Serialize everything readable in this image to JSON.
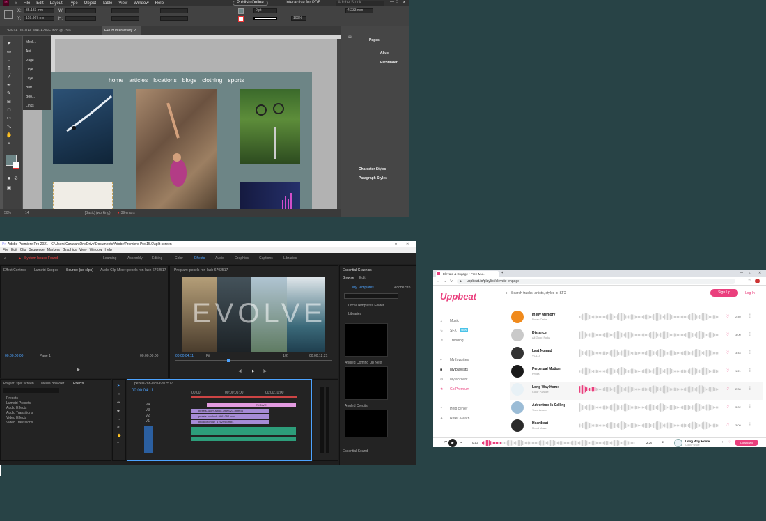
{
  "indesign": {
    "menus": [
      "File",
      "Edit",
      "Layout",
      "Type",
      "Object",
      "Table",
      "View",
      "Window",
      "Help"
    ],
    "publish_label": "Publish Online",
    "interactive_preset": "Interactive for PDF",
    "search_placeholder": "Adobe Stock",
    "x_value": "35.133 mm",
    "y_value": "159.967 mm",
    "stroke_value": "0 pt",
    "stroke_width": "4.233 mm",
    "zoom_pct": "100%",
    "doc_tabs": [
      "*EMLA DIGITAL MAGAZINE.indd @ 75%",
      "EPUB Interactivity P..."
    ],
    "flyout_items": [
      "Med...",
      "Ani...",
      "Page...",
      "Obje...",
      "Laye...",
      "Butt...",
      "Boo...",
      "Links"
    ],
    "nav_links": [
      "home",
      "articles",
      "locations",
      "blogs",
      "clothing",
      "sports"
    ],
    "status": {
      "zoom": "50%",
      "page": "14",
      "style": "[Basic] (working)",
      "errors": "39 errors"
    },
    "panels": [
      "Pages",
      "Align",
      "Pathfinder",
      "Character Styles",
      "Paragraph Styles"
    ]
  },
  "premiere": {
    "title": "Adobe Premiere Pro 2021 - C:\\Users\\Caravan\\OneDrive\\Documents\\Adobe\\Premiere Pro\\15.0\\split screen",
    "menus": [
      "File",
      "Edit",
      "Clip",
      "Sequence",
      "Markers",
      "Graphics",
      "View",
      "Window",
      "Help"
    ],
    "system_alert": "System Issues Found",
    "workspaces": [
      "Learning",
      "Assembly",
      "Editing",
      "Color",
      "Effects",
      "Audio",
      "Graphics",
      "Captions",
      "Libraries"
    ],
    "source_tabs": [
      "Effect Controls",
      "Lumetri Scopes",
      "Source: (no clips)",
      "Audio Clip Mixer: pexels-ron-lach-6702517"
    ],
    "program_title": "Program: pexels-ron-lach-6702517",
    "program_tc": "00:00:04:11",
    "program_fit": "Fit",
    "program_fraction": "1/2",
    "program_dur": "00:00:12:21",
    "source_tc_left": "00:00:00:00",
    "source_tc_right": "00:00:00:00",
    "source_page": "Page 1",
    "overlay_text": "EVOLVE",
    "eg_title": "Essential Graphics",
    "eg_tabs": [
      "Browse",
      "Edit"
    ],
    "eg_templates": "My Templates",
    "eg_adobe": "Adobe Sto",
    "eg_local": "Local Templates Folder",
    "eg_libraries": "Libraries",
    "eg_items": [
      "Angled Coming Up Next",
      "Angled Credits"
    ],
    "eg_footer": "Essential Sound",
    "project_tabs": [
      "Project: split screen",
      "Media Browser",
      "Effects"
    ],
    "bins": [
      "Presets",
      "Lumetri Presets",
      "Audio Effects",
      "Audio Transitions",
      "Video Effects",
      "Video Transitions"
    ],
    "seq_name": "pexels-ron-lach-6702517",
    "seq_tc": "00:00:04:11",
    "ruler": [
      "00:00",
      "00:00:05:00",
      "00:00:10:00"
    ],
    "clips": [
      "EVOLVE",
      "pexels-kaom-shiko-7990323-m.mp4",
      "pexels-ron-lach-9961052.mp4",
      "production ID_4762993.mp4"
    ],
    "tracks": [
      "V4",
      "V3",
      "V2",
      "V1",
      "A1",
      "A2",
      "A3"
    ]
  },
  "uppbeat": {
    "tab_title": "Elevate & Engage • Free Mu...",
    "url": "uppbeat.io/playlist/elevate-engage",
    "logo": "Uppbeat",
    "search_placeholder": "Search tracks, artists, styles or SFX",
    "signup": "Sign Up",
    "login": "Log In",
    "nav": [
      {
        "label": "Music",
        "icon": "music-note-icon"
      },
      {
        "label": "SFX",
        "icon": "sfx-icon",
        "badge": "NEW"
      },
      {
        "label": "Trending",
        "icon": "trending-icon"
      },
      {
        "label": "My favorites",
        "icon": "heart-icon"
      },
      {
        "label": "My playlists",
        "icon": "playlist-icon"
      },
      {
        "label": "My account",
        "icon": "account-icon"
      },
      {
        "label": "Go Premium",
        "icon": "star-icon"
      },
      {
        "label": "Help center",
        "icon": "help-icon"
      },
      {
        "label": "Refer & earn",
        "icon": "gift-icon"
      }
    ],
    "tracks": [
      {
        "title": "In My Memory",
        "artist": "Nolan Cates",
        "duration": "2:40",
        "color": "#f08a1c"
      },
      {
        "title": "Distance",
        "artist": "All Good Folks",
        "duration": "3:00",
        "color": "#c9c9c9"
      },
      {
        "title": "Last Nomad",
        "artist": "VOLO",
        "duration": "3:44",
        "color": "#333333"
      },
      {
        "title": "Perpetual Motion",
        "artist": "Pryda",
        "duration": "1:21",
        "color": "#1a1a1a"
      },
      {
        "title": "Long Way Home",
        "artist": "Color Parade",
        "duration": "2:36",
        "color": "#e8f1f6"
      },
      {
        "title": "Adventure Is Calling",
        "artist": "Vaxo Adams",
        "duration": "3:02",
        "color": "#9bbcd6"
      },
      {
        "title": "Heartbeat",
        "artist": "Mood Maze",
        "duration": "3:09",
        "color": "#2a2a2a"
      }
    ],
    "player": {
      "time_start": "0:03",
      "time_end": "2:36",
      "title": "Long Way Home",
      "artist": "Color Parade",
      "download": "Download"
    }
  }
}
